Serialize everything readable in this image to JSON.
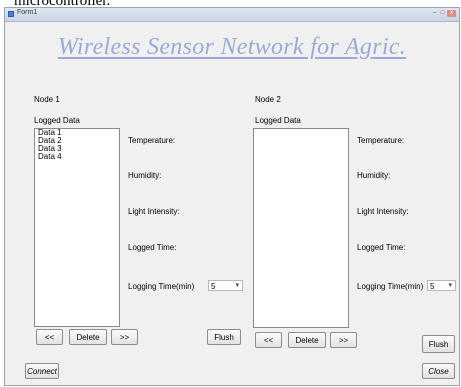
{
  "page_top_text": "microcontroller.",
  "window": {
    "title": "Form1",
    "controls": {
      "minimize": "–",
      "maximize": "□",
      "close": "x"
    }
  },
  "header": {
    "title": "Wireless Sensor Network for Agric."
  },
  "node1": {
    "label": "Node 1",
    "logged_label": "Logged Data",
    "items": [
      "Data 1",
      "Data 2",
      "Data 3",
      "Data 4"
    ],
    "temperature_label": "Temperature:",
    "humidity_label": "Humidity:",
    "light_label": "Light Intensity:",
    "logged_time_label": "Logged Time:",
    "logging_time_label": "Logging Time(min)",
    "logging_time_value": "5",
    "prev_label": "<<",
    "delete_label": "Delete",
    "next_label": ">>",
    "flush_label": "Flush"
  },
  "node2": {
    "label": "Node 2",
    "logged_label": "Logged Data",
    "items": [],
    "temperature_label": "Temperature:",
    "humidity_label": "Humidity:",
    "light_label": "Light Intensity:",
    "logged_time_label": "Logged Time:",
    "logging_time_label": "Logging Time(min)",
    "logging_time_value": "5",
    "prev_label": "<<",
    "delete_label": "Delete",
    "next_label": ">>",
    "flush_label": "Flush"
  },
  "footer": {
    "connect_label": "Connect",
    "close_label": "Close"
  },
  "colors": {
    "title": "#9aaad4",
    "window_bg": "#f0f0f0",
    "status_text": "#b64040"
  },
  "icons": {
    "window": "app-icon",
    "dropdown": "chevron-down-icon"
  }
}
